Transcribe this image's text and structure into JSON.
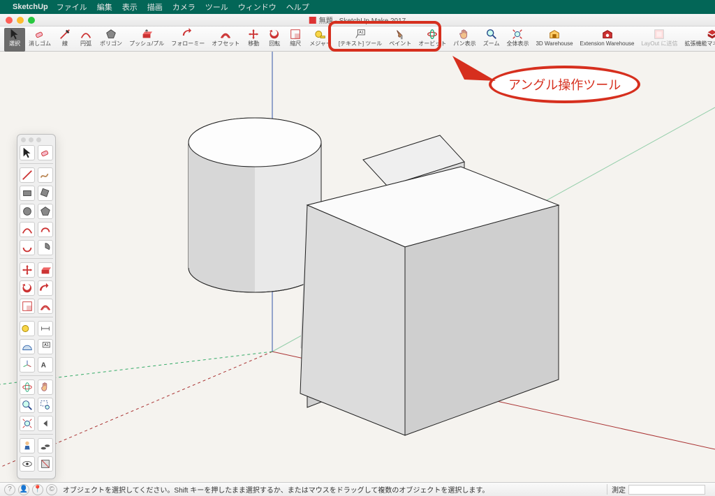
{
  "menubar": {
    "appname": "SketchUp",
    "items": [
      "ファイル",
      "編集",
      "表示",
      "描画",
      "カメラ",
      "ツール",
      "ウィンドウ",
      "ヘルプ"
    ]
  },
  "window": {
    "title": "無題 - SketchUp Make 2017"
  },
  "toolbar": [
    {
      "name": "select",
      "label": "選択",
      "icon": "cursor",
      "sel": true
    },
    {
      "name": "eraser",
      "label": "消しゴム",
      "icon": "eraser"
    },
    {
      "name": "line",
      "label": "線",
      "icon": "pencil"
    },
    {
      "name": "arc",
      "label": "円弧",
      "icon": "arc"
    },
    {
      "name": "shape",
      "label": "ポリゴン",
      "icon": "polygon"
    },
    {
      "name": "pushpull",
      "label": "プッシュ/プル",
      "icon": "pushpull"
    },
    {
      "name": "followme",
      "label": "フォローミー",
      "icon": "followme"
    },
    {
      "name": "offset",
      "label": "オフセット",
      "icon": "offset"
    },
    {
      "name": "move",
      "label": "移動",
      "icon": "move"
    },
    {
      "name": "rotate",
      "label": "回転",
      "icon": "rotate"
    },
    {
      "name": "scale",
      "label": "縮尺",
      "icon": "scale"
    },
    {
      "name": "tape",
      "label": "メジャー",
      "icon": "tape"
    },
    {
      "name": "text",
      "label": "[テキスト] ツール",
      "icon": "text"
    },
    {
      "name": "paint",
      "label": "ペイント",
      "icon": "paint"
    },
    {
      "name": "orbit",
      "label": "オービット",
      "icon": "orbit"
    },
    {
      "name": "pan",
      "label": "パン表示",
      "icon": "pan"
    },
    {
      "name": "zoom",
      "label": "ズーム",
      "icon": "zoom"
    },
    {
      "name": "zoomext",
      "label": "全体表示",
      "icon": "zoomext"
    },
    {
      "name": "3dwh",
      "label": "3D Warehouse",
      "icon": "3dwh"
    },
    {
      "name": "extwh",
      "label": "Extension Warehouse",
      "icon": "extwh"
    },
    {
      "name": "layout",
      "label": "LayOut に送信",
      "icon": "layout",
      "dim": true
    },
    {
      "name": "extmgr",
      "label": "拡張機能マネージャー",
      "icon": "extmgr"
    }
  ],
  "callout": {
    "text": "アングル操作ツール"
  },
  "statusbar": {
    "message": "オブジェクトを選択してください。Shift キーを押したまま選択するか、またはマウスをドラッグして複数のオブジェクトを選択します。",
    "measure_label": "測定"
  },
  "colors": {
    "accent": "#d62f1e",
    "menubar": "#036657"
  }
}
